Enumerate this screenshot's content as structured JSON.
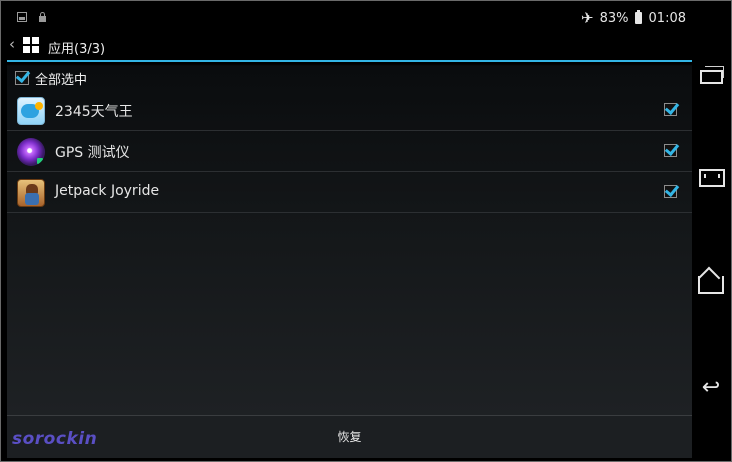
{
  "status_bar": {
    "left_icons": [
      "image-icon",
      "lock-icon"
    ],
    "airplane_icon": "airplane-icon",
    "battery_percent": "83%",
    "battery_icon": "battery-icon",
    "time": "01:08"
  },
  "action_bar": {
    "back_glyph": "‹",
    "grid_icon": "grid-icon",
    "title": "应用(3/3)"
  },
  "select_all": {
    "label": "全部选中",
    "checked": true
  },
  "apps": [
    {
      "name": "2345天气王",
      "icon": "weather-app-icon",
      "checked": true
    },
    {
      "name": "GPS 测试仪",
      "icon": "gps-test-app-icon",
      "checked": true
    },
    {
      "name": "Jetpack Joyride",
      "icon": "jetpack-joyride-app-icon",
      "checked": true
    }
  ],
  "bottom_bar": {
    "restore_label": "恢复"
  },
  "watermark": "sorockin",
  "nav_bar": {
    "buttons": [
      "recent-apps-icon",
      "fullscreen-icon",
      "home-icon",
      "back-icon"
    ],
    "back_glyph": "↩"
  },
  "colors": {
    "accent": "#33b5e5",
    "watermark": "#5a4fc4"
  }
}
